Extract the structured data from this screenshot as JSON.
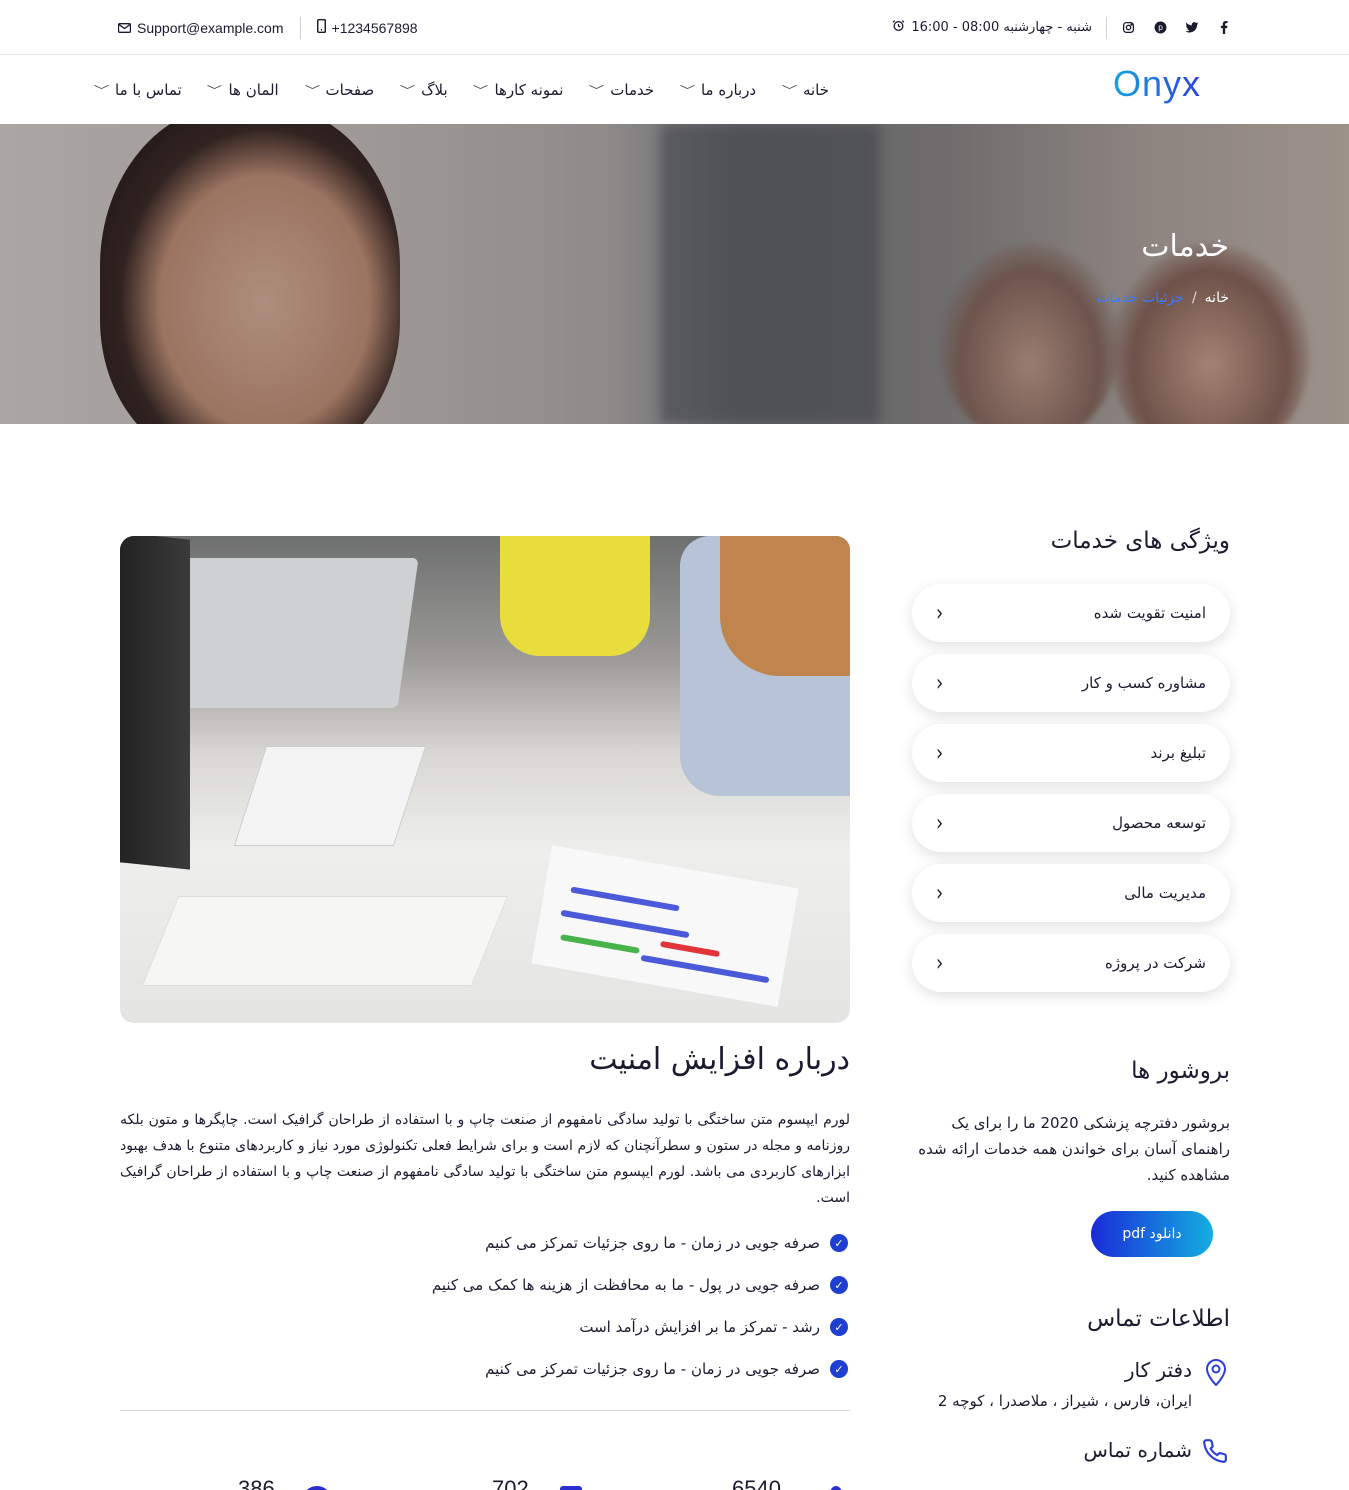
{
  "topbar": {
    "hours": "شنبه - چهارشنبه 08:00 - 16:00",
    "phone": "+1234567898",
    "email": "Support@example.com",
    "social": [
      "instagram-icon",
      "pinterest-icon",
      "twitter-icon",
      "facebook-icon"
    ]
  },
  "nav": {
    "logo": "Onyx",
    "items": [
      {
        "label": "خانه"
      },
      {
        "label": "درباره ما"
      },
      {
        "label": "خدمات"
      },
      {
        "label": "نمونه کارها"
      },
      {
        "label": "بلاگ"
      },
      {
        "label": "صفحات"
      },
      {
        "label": "المان ها"
      },
      {
        "label": "تماس با ما"
      }
    ]
  },
  "hero": {
    "title": "خدمات",
    "breadcrumb_home": "خانه",
    "breadcrumb_current": "جزئیات خدمات"
  },
  "sidebar": {
    "title": "ویژگی های خدمات",
    "services": [
      "امنیت تقویت شده",
      "مشاوره کسب و کار",
      "تبلیغ برند",
      "توسعه محصول",
      "مدیریت مالی",
      "شرکت در پروژه"
    ],
    "brochure_title": "بروشور ها",
    "brochure_text": "بروشور دفترچه پزشکی 2020 ما را برای یک راهنمای آسان برای خواندن همه خدمات ارائه شده مشاهده کنید.",
    "download_label": "دانلود pdf",
    "contact_title": "اطلاعات تماس",
    "office_title": "دفتر کار",
    "office_address": "ایران، فارس ، شیراز ، ملاصدرا ، کوچه 2",
    "phone_title": "شماره تماس"
  },
  "main": {
    "title": "درباره افزایش امنیت",
    "paragraph": "لورم ایپسوم متن ساختگی با تولید سادگی نامفهوم از صنعت چاپ و با استفاده از طراحان گرافیک است. چاپگرها و متون بلکه روزنامه و مجله در ستون و سطرآنچنان که لازم است و برای شرایط فعلی تکنولوژی مورد نیاز و کاربردهای متنوع با هدف بهبود ابزارهای کاربردی می باشد. لورم ایپسوم متن ساختگی با تولید سادگی نامفهوم از صنعت چاپ و با استفاده از طراحان گرافیک است.",
    "features": [
      "صرفه جویی در زمان - ما روی جزئیات تمرکز می کنیم",
      "صرفه جویی در پول - ما به محافظت از هزینه ها کمک می کنیم",
      "رشد - تمرکز ما بر افزایش درآمد است",
      "صرفه جویی در زمان - ما روی جزئیات تمرکز می کنیم"
    ],
    "stats": [
      "6540",
      "702",
      "386"
    ]
  },
  "colors": {
    "accent": "#1e3fd0",
    "gradient_start": "#1a2bd8",
    "gradient_end": "#14aee0",
    "breadcrumb_active": "#3a7bff"
  }
}
